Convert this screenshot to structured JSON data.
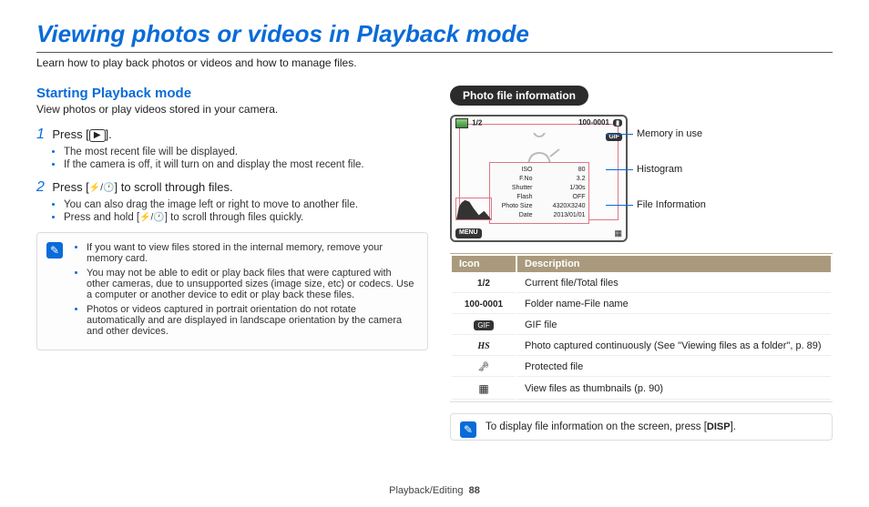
{
  "title": "Viewing photos or videos in Playback mode",
  "intro": "Learn how to play back photos or videos and how to manage files.",
  "left": {
    "heading": "Starting Playback mode",
    "sub": "View photos or play videos stored in your camera.",
    "step1": {
      "text_a": "Press [",
      "text_b": "].",
      "bullets": [
        "The most recent file will be displayed.",
        "If the camera is off, it will turn on and display the most recent file."
      ]
    },
    "step2": {
      "text_a": "Press [",
      "text_b": "] to scroll through files.",
      "bullets_a": "You can also drag the image left or right to move to another file.",
      "bullets_b1": "Press and hold [",
      "bullets_b2": "] to scroll through files quickly."
    },
    "notes": [
      "If you want to view files stored in the internal memory, remove your memory card.",
      "You may not be able to edit or play back files that were captured with other cameras, due to unsupported sizes (image size, etc) or codecs. Use a computer or another device to edit or play back these files.",
      "Photos or videos captured in portrait orientation do not rotate automatically and are displayed in landscape orientation by the camera and other devices."
    ]
  },
  "right": {
    "pill": "Photo file information",
    "labels": {
      "memory": "Memory in use",
      "histogram": "Histogram",
      "fileinfo": "File Information"
    },
    "screen": {
      "counter": "1/2",
      "folder": "100-0001",
      "gif": "GIF",
      "info": [
        {
          "k": "ISO",
          "v": "80"
        },
        {
          "k": "F.No",
          "v": "3.2"
        },
        {
          "k": "Shutter",
          "v": "1/30s"
        },
        {
          "k": "Flash",
          "v": "OFF"
        },
        {
          "k": "Photo Size",
          "v": "4320X3240"
        },
        {
          "k": "Date",
          "v": "2013/01/01"
        }
      ],
      "menu": "MENU"
    },
    "table": {
      "h1": "Icon",
      "h2": "Description",
      "rows": [
        {
          "icon": "1/2",
          "desc": "Current file/Total files"
        },
        {
          "icon": "100-0001",
          "desc": "Folder name-File name"
        },
        {
          "icon": "GIF",
          "desc": "GIF file"
        },
        {
          "icon": "HS",
          "desc": "Photo captured continuously (See \"Viewing files as a folder\", p. 89)"
        },
        {
          "icon": "KEY",
          "desc": "Protected file"
        },
        {
          "icon": "GRID",
          "desc": "View files as thumbnails (p. 90)"
        }
      ]
    },
    "tip_a": "To display file information on the screen, press [",
    "tip_b": "].",
    "disp": "DISP"
  },
  "footer": {
    "section": "Playback/Editing",
    "page": "88"
  }
}
